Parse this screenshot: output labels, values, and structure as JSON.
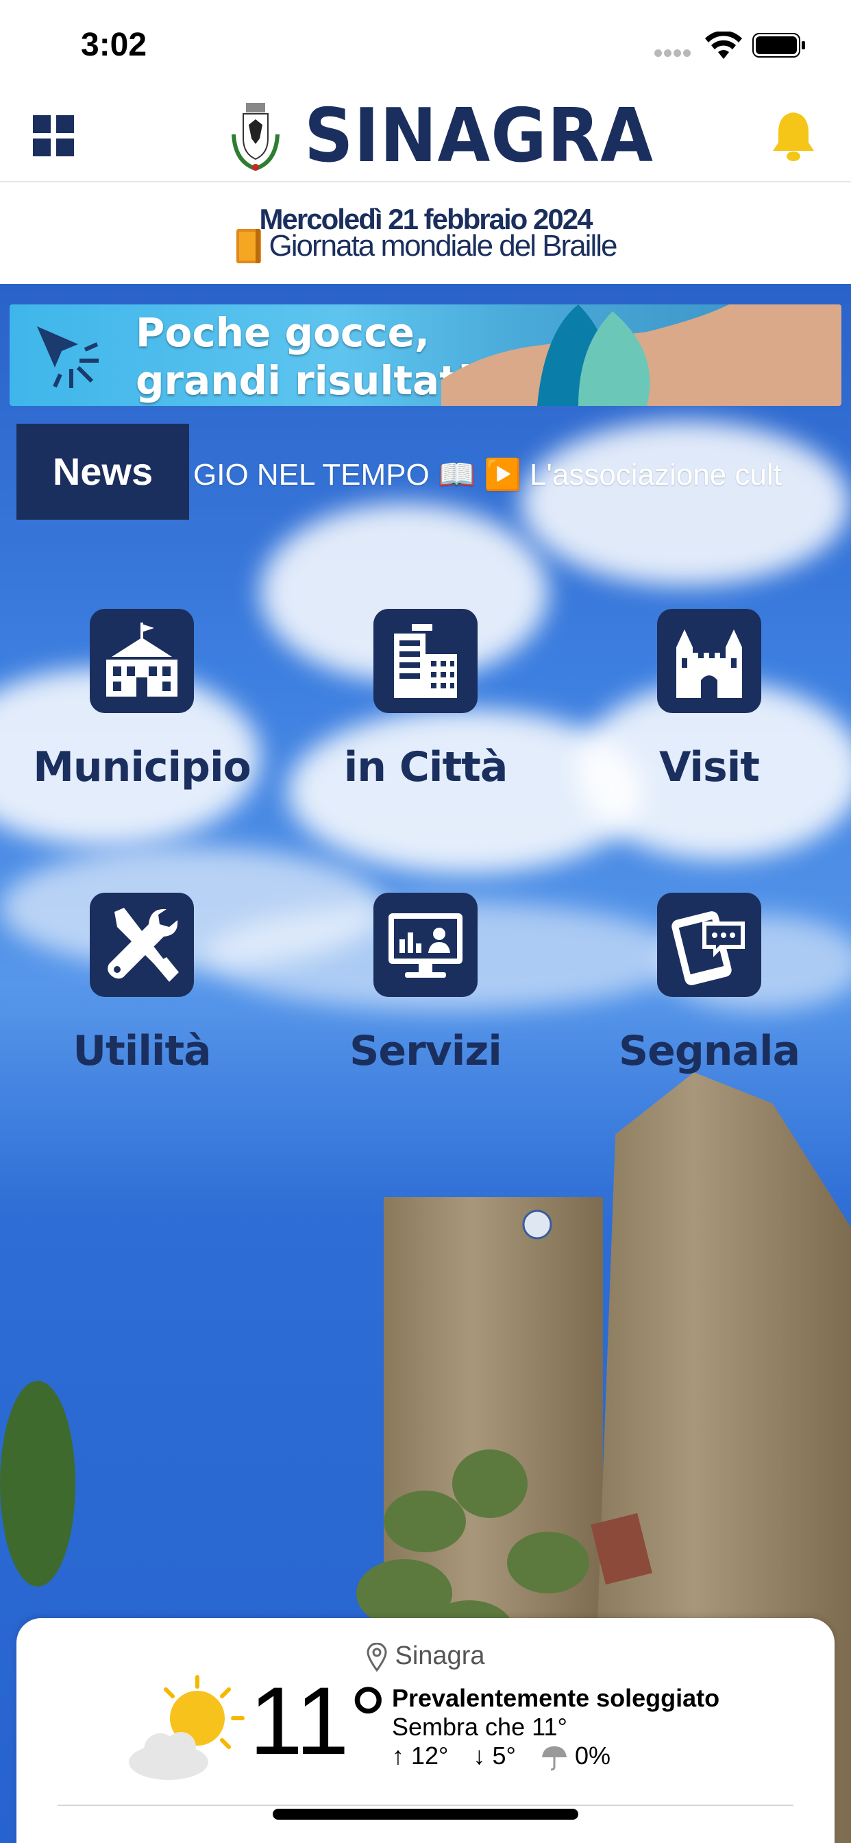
{
  "status_bar": {
    "time": "3:02"
  },
  "header": {
    "title": "SINAGRA"
  },
  "date_banner": {
    "date": "Mercoledì 21 febbraio 2024",
    "event": "Giornata mondiale del Braille"
  },
  "ad": {
    "line1": "Poche gocce,",
    "line2": "grandi risultati"
  },
  "news": {
    "label": "News",
    "ticker": "GIO NEL TEMPO 📖 ▶️ L'associazione cult"
  },
  "tiles": [
    {
      "label": "Municipio"
    },
    {
      "label": "in Città"
    },
    {
      "label": "Visit"
    },
    {
      "label": "Utilità"
    },
    {
      "label": "Servizi"
    },
    {
      "label": "Segnala"
    }
  ],
  "weather": {
    "location": "Sinagra",
    "temperature": "11°",
    "condition": "Prevalentemente soleggiato",
    "feels_like": "Sembra che 11°",
    "max": "12°",
    "min": "5°",
    "precipitation": "0%"
  },
  "colors": {
    "brand": "#1b2f5e",
    "bell": "#f5c518"
  }
}
